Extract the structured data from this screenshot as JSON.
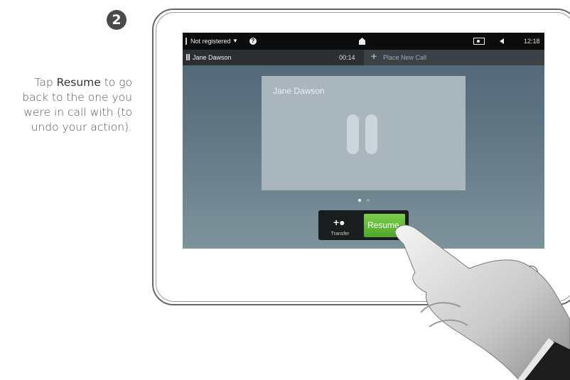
{
  "step": {
    "number": "2"
  },
  "instruction": {
    "prefix": "Tap ",
    "bold": "Resume",
    "suffix": " to go back to the one you were in call with (to undo your action)."
  },
  "status_bar": {
    "registration": "Not registered",
    "caret": "▼",
    "help": "?",
    "time": "12:18"
  },
  "call_bar": {
    "caller": "Jane Dawson",
    "duration": "00:14",
    "new_call": "Place New Call"
  },
  "held_call": {
    "name": "Jane Dawson"
  },
  "pager": {
    "pages": 2,
    "active": 1
  },
  "actions": {
    "transfer_label": "Transfer",
    "resume_label": "Resume"
  },
  "colors": {
    "resume": "#5cb833",
    "status_bar": "#0c0c0c",
    "screen_bg": "#5f7683"
  }
}
